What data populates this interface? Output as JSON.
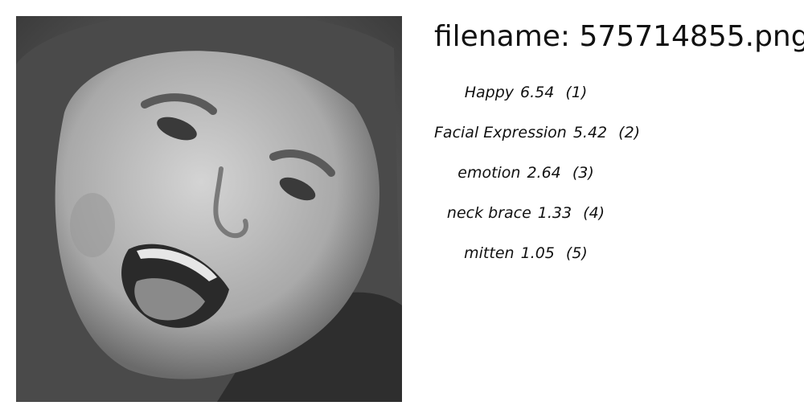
{
  "filename_text": "filename: 575714855.png",
  "photo": {
    "description_icon": "face-photo",
    "colors": {
      "background": "#6f6f6f",
      "skin": "#b8b8b8",
      "hair": "#3a3a3a",
      "mouth": "#2a2a2a",
      "tongue": "#8a8a8a"
    }
  },
  "labels": [
    {
      "name": "Happy",
      "score": "6.54",
      "rank": "(1)"
    },
    {
      "name": "Facial Expression",
      "score": "5.42",
      "rank": "(2)"
    },
    {
      "name": "emotion",
      "score": "2.64",
      "rank": "(3)"
    },
    {
      "name": "neck brace",
      "score": "1.33",
      "rank": "(4)"
    },
    {
      "name": "mitten",
      "score": "1.05",
      "rank": "(5)"
    }
  ]
}
